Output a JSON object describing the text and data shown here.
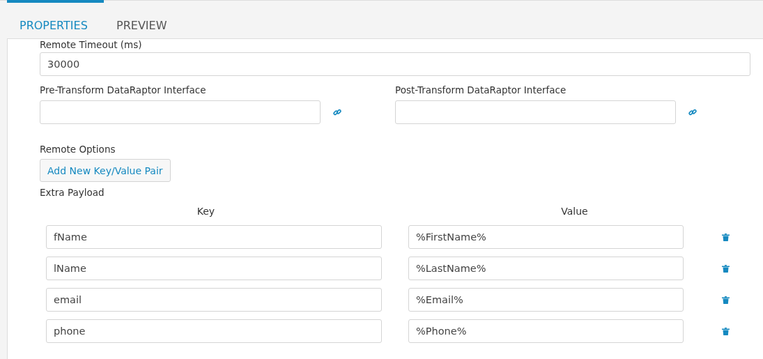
{
  "tabs": [
    {
      "label": "PROPERTIES",
      "selected": true
    },
    {
      "label": "PREVIEW",
      "selected": false
    }
  ],
  "timeout": {
    "label": "Remote Timeout (ms)",
    "value": "30000"
  },
  "interfaces": [
    {
      "label": "Pre-Transform DataRaptor Interface"
    },
    {
      "label": "Post-Transform DataRaptor Interface"
    }
  ],
  "remote_options": {
    "label": "Remote Options",
    "add_button": "Add New Key/Value Pair"
  },
  "extra_payload": {
    "label": "Extra Payload",
    "key_header": "Key",
    "value_header": "Value",
    "rows": [
      {
        "key": "fName",
        "value": "%FirstName%"
      },
      {
        "key": "lName",
        "value": "%LastName%"
      },
      {
        "key": "email",
        "value": "%Email%"
      },
      {
        "key": "phone",
        "value": "%Phone%"
      }
    ]
  }
}
